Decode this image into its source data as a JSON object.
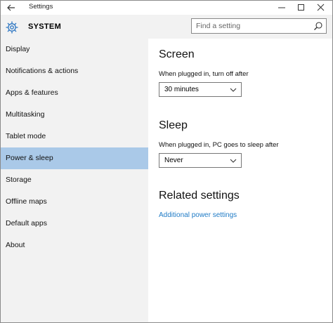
{
  "titlebar": {
    "title": "Settings"
  },
  "header": {
    "section": "SYSTEM"
  },
  "search": {
    "placeholder": "Find a setting"
  },
  "sidebar": {
    "items": [
      {
        "label": "Display"
      },
      {
        "label": "Notifications & actions"
      },
      {
        "label": "Apps & features"
      },
      {
        "label": "Multitasking"
      },
      {
        "label": "Tablet mode"
      },
      {
        "label": "Power & sleep"
      },
      {
        "label": "Storage"
      },
      {
        "label": "Offline maps"
      },
      {
        "label": "Default apps"
      },
      {
        "label": "About"
      }
    ],
    "active_index": 5
  },
  "screen": {
    "heading": "Screen",
    "label": "When plugged in, turn off after",
    "value": "30 minutes"
  },
  "sleep": {
    "heading": "Sleep",
    "label": "When plugged in, PC goes to sleep after",
    "value": "Never"
  },
  "related": {
    "heading": "Related settings",
    "link": "Additional power settings"
  },
  "colors": {
    "accent": "#1f7bc6",
    "active_item": "#aac9e8",
    "header_bg": "#f2f2f2"
  },
  "icons": {
    "back": "back-arrow-icon",
    "settings": "gear-icon",
    "search": "search-icon"
  }
}
